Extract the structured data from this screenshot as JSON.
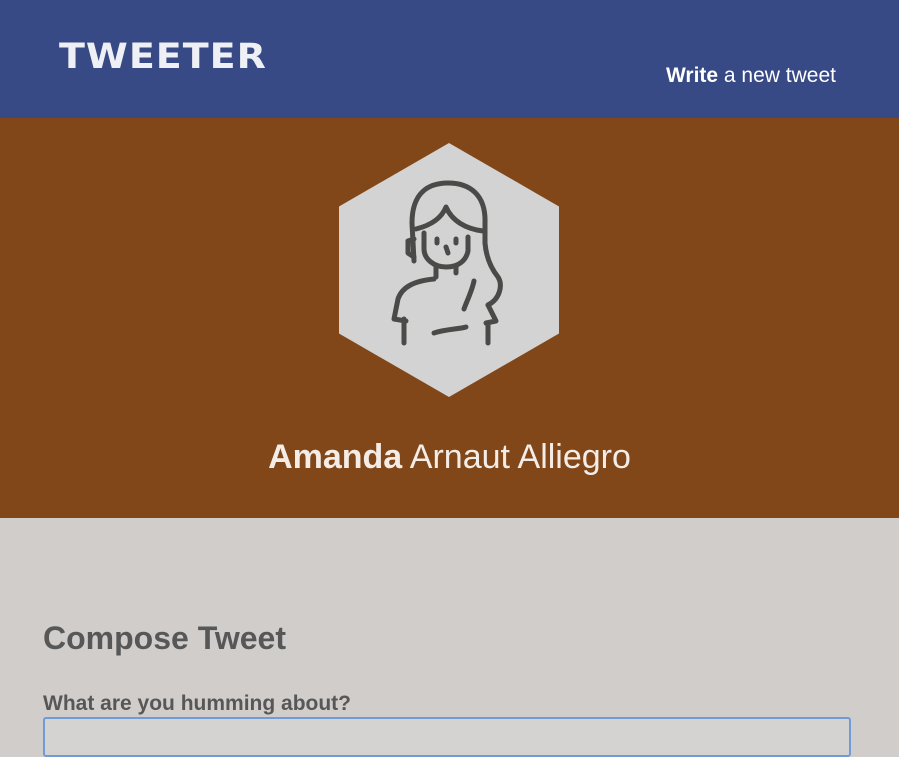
{
  "navbar": {
    "brand": "TWEETER",
    "compose_link": {
      "strong": "Write",
      "light": "a new tweet"
    }
  },
  "profile": {
    "avatar_icon": "woman-avatar-icon",
    "first_name": "Amanda",
    "last_name": "Arnaut Alliegro"
  },
  "compose": {
    "title": "Compose Tweet",
    "label": "What are you humming about?",
    "input_value": "",
    "input_placeholder": ""
  },
  "colors": {
    "navbar_bg": "#374a85",
    "profile_bg": "#814718",
    "page_bg": "#d0cdcb",
    "hexagon_fill": "#d3d3d3",
    "icon_stroke": "#4a4a48",
    "input_border": "#6f9bd8"
  }
}
